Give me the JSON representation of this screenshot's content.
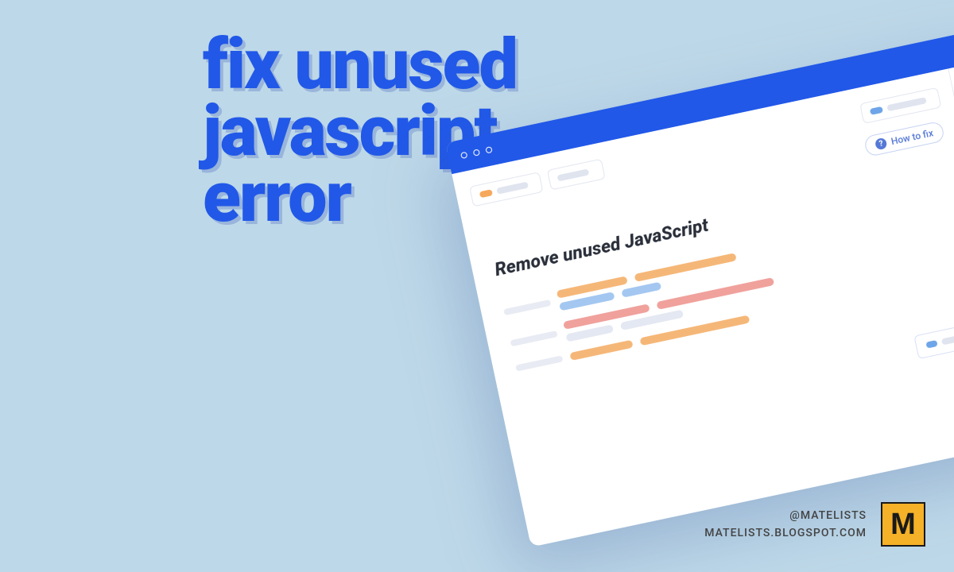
{
  "headline": {
    "line1": "fix unused",
    "line2": "javascript",
    "line3": "error"
  },
  "browser": {
    "how_to_fix_label": "How to fix",
    "section_heading": "Remove unused JavaScript"
  },
  "footer": {
    "handle": "@MATELISTS",
    "url": "MATELISTS.BLOGSPOT.COM",
    "logo_letter": "M"
  }
}
